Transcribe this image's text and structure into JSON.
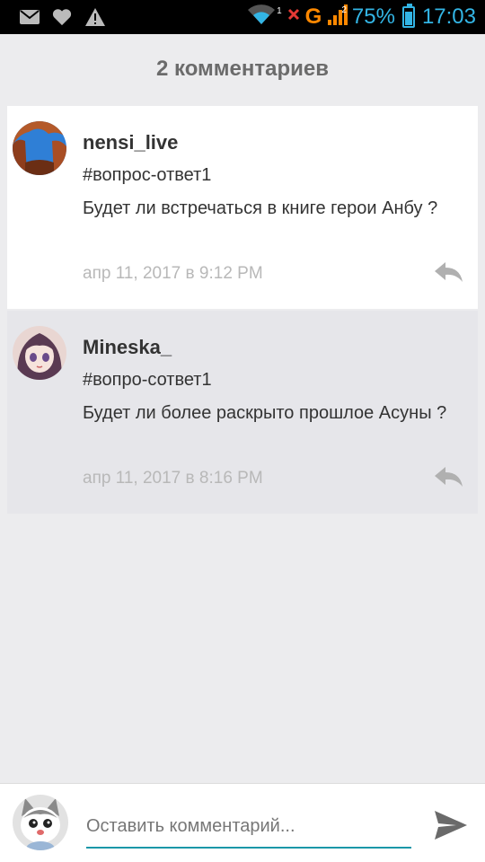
{
  "status_bar": {
    "wifi_badge": "1",
    "network": "G",
    "signal_badge": "2",
    "battery": "75%",
    "battery_level": 0.75,
    "time": "17:03",
    "colors": {
      "accent": "#33b5e5",
      "network": "#ff8800",
      "alert": "#e53935"
    }
  },
  "header": {
    "title": "2 комментариев"
  },
  "comments": [
    {
      "username": "nensi_live",
      "tag": "#вопрос-ответ1",
      "text": "Будет ли встречаться в книге герои Анбу ?",
      "date": "апр 11, 2017 в 9:12 PM",
      "avatar_icon": "rock-arch-avatar"
    },
    {
      "username": "Mineska_",
      "tag": "#вопро-сответ1",
      "text": "Будет ли более раскрыто прошлое Асуны ?",
      "date": "апр 11, 2017 в 8:16 PM",
      "avatar_icon": "anime-girl-avatar"
    }
  ],
  "compose": {
    "placeholder": "Оставить комментарий...",
    "value": "",
    "avatar_icon": "cat-avatar",
    "accent": "#1a97a8"
  }
}
